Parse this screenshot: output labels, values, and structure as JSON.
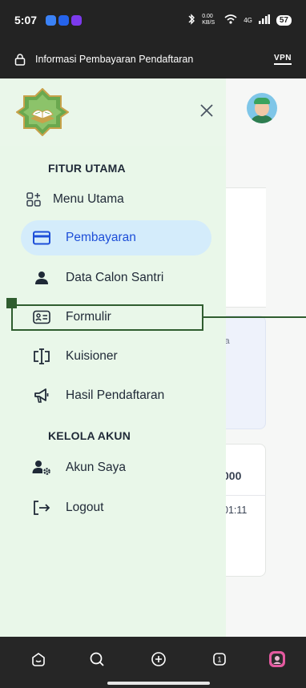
{
  "status_bar": {
    "time": "5:07",
    "app_icons": [
      {
        "name": "app-blue-icon",
        "color": "#3b82f6"
      },
      {
        "name": "app-blue-icon",
        "color": "#2563eb"
      },
      {
        "name": "app-purple-icon",
        "color": "#7c3aed"
      }
    ],
    "net_speed": "0.00 KB/S",
    "net_type": "4G",
    "battery": "57"
  },
  "url_bar": {
    "title": "Informasi Pembayaran Pendaftaran",
    "vpn_label": "VPN"
  },
  "drawer": {
    "section_main": "FITUR UTAMA",
    "section_account": "KELOLA AKUN",
    "items": [
      {
        "label": "Menu Utama",
        "icon": "dashboard-icon"
      },
      {
        "label": "Pembayaran",
        "icon": "credit-card-icon"
      },
      {
        "label": "Data Calon Santri",
        "icon": "person-icon"
      },
      {
        "label": "Formulir",
        "icon": "id-card-icon"
      },
      {
        "label": "Kuisioner",
        "icon": "questionnaire-icon"
      },
      {
        "label": "Hasil Pendaftaran",
        "icon": "megaphone-icon"
      }
    ],
    "account_items": [
      {
        "label": "Akun Saya",
        "icon": "user-settings-icon"
      },
      {
        "label": "Logout",
        "icon": "logout-icon"
      }
    ]
  },
  "background_page": {
    "partial_text_1": "ia",
    "partial_amount": "000",
    "partial_time": "01:11"
  },
  "colors": {
    "drawer_bg": "#e9f7e9",
    "active_bg": "#d4ecfb",
    "active_text": "#1d4ed8",
    "highlight": "#2f5d2f",
    "system_bar": "#232323"
  }
}
